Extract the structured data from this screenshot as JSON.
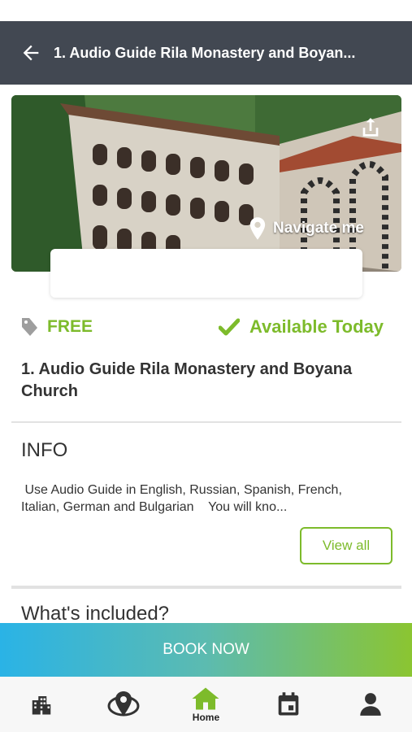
{
  "header": {
    "title": "1. Audio Guide Rila Monastery and Boyan..."
  },
  "hero": {
    "navigate_label": "Navigate me"
  },
  "price": {
    "label": "FREE"
  },
  "availability": {
    "label": "Available Today"
  },
  "tour": {
    "title": "1. Audio Guide Rila Monastery and Boyana Church"
  },
  "info": {
    "heading": "INFO",
    "text": " Use Audio Guide in English, Russian, Spanish, French, Italian, German and Bulgarian    You will kno...",
    "view_all_label": "View all"
  },
  "included": {
    "heading": "What's included?"
  },
  "book": {
    "label": "BOOK NOW"
  },
  "bottom_nav": {
    "home_label": "Home",
    "active_color": "#7dbb2b"
  },
  "colors": {
    "header_bg": "#424852",
    "accent_green": "#7dbb2b",
    "book_gradient_start": "#2ab3e6",
    "book_gradient_end": "#8bc531"
  }
}
